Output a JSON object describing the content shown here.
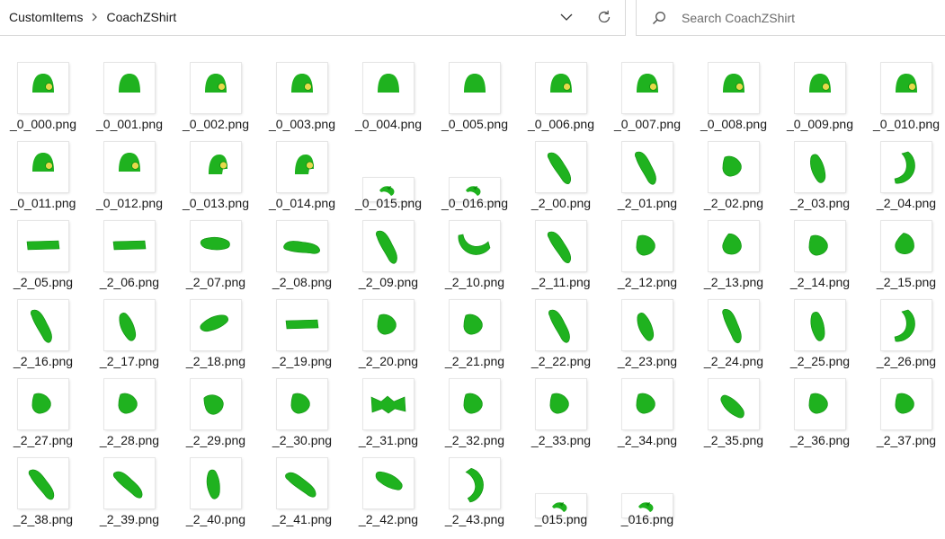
{
  "address": {
    "breadcrumbs": [
      "CustomItems",
      "CoachZShirt"
    ],
    "separator_icon": "chevron-right-icon",
    "dropdown_icon": "chevron-down-icon",
    "refresh_icon": "refresh-icon"
  },
  "search": {
    "placeholder": "Search CoachZShirt",
    "icon": "search-icon"
  },
  "colors": {
    "shape_green": "#1fb21f",
    "shape_green_dark": "#0d8f0d",
    "badge_yellow": "#e6d94a"
  },
  "files": [
    {
      "name": "_0_000.png",
      "kind": "hat-badge"
    },
    {
      "name": "_0_001.png",
      "kind": "hat"
    },
    {
      "name": "_0_002.png",
      "kind": "hat-badge"
    },
    {
      "name": "_0_003.png",
      "kind": "hat-badge"
    },
    {
      "name": "_0_004.png",
      "kind": "hat"
    },
    {
      "name": "_0_005.png",
      "kind": "hat"
    },
    {
      "name": "_0_006.png",
      "kind": "hat-badge"
    },
    {
      "name": "_0_007.png",
      "kind": "hat-badge"
    },
    {
      "name": "_0_008.png",
      "kind": "hat-badge"
    },
    {
      "name": "_0_009.png",
      "kind": "hat-badge"
    },
    {
      "name": "_0_010.png",
      "kind": "hat-badge"
    },
    {
      "name": "_0_011.png",
      "kind": "hat-badge"
    },
    {
      "name": "_0_012.png",
      "kind": "hat-badge"
    },
    {
      "name": "_0_013.png",
      "kind": "hat-half"
    },
    {
      "name": "_0_014.png",
      "kind": "hat-half"
    },
    {
      "name": "_0_015.png",
      "kind": "strip"
    },
    {
      "name": "_0_016.png",
      "kind": "strip"
    },
    {
      "name": "_2_00.png",
      "kind": "piece",
      "shape": 1,
      "rot": 30
    },
    {
      "name": "_2_01.png",
      "kind": "piece",
      "shape": 1,
      "rot": 35
    },
    {
      "name": "_2_02.png",
      "kind": "piece",
      "shape": 4,
      "rot": 0
    },
    {
      "name": "_2_03.png",
      "kind": "piece",
      "shape": 0,
      "rot": -55
    },
    {
      "name": "_2_04.png",
      "kind": "piece",
      "shape": 3,
      "rot": 0
    },
    {
      "name": "_2_05.png",
      "kind": "piece",
      "shape": 2,
      "rot": 0
    },
    {
      "name": "_2_06.png",
      "kind": "piece",
      "shape": 2,
      "rot": 0
    },
    {
      "name": "_2_07.png",
      "kind": "piece",
      "shape": 0,
      "rot": 55
    },
    {
      "name": "_2_08.png",
      "kind": "piece",
      "shape": 1,
      "rot": -20
    },
    {
      "name": "_2_09.png",
      "kind": "piece",
      "shape": 1,
      "rot": 35
    },
    {
      "name": "_2_10.png",
      "kind": "piece",
      "shape": 3,
      "rot": 90
    },
    {
      "name": "_2_11.png",
      "kind": "piece",
      "shape": 1,
      "rot": 30
    },
    {
      "name": "_2_12.png",
      "kind": "piece",
      "shape": 4,
      "rot": 0
    },
    {
      "name": "_2_13.png",
      "kind": "piece",
      "shape": 4,
      "rot": 20
    },
    {
      "name": "_2_14.png",
      "kind": "piece",
      "shape": 4,
      "rot": 0
    },
    {
      "name": "_2_15.png",
      "kind": "piece",
      "shape": 4,
      "rot": 30
    },
    {
      "name": "_2_16.png",
      "kind": "piece",
      "shape": 1,
      "rot": 35
    },
    {
      "name": "_2_17.png",
      "kind": "piece",
      "shape": 0,
      "rot": -60
    },
    {
      "name": "_2_18.png",
      "kind": "piece",
      "shape": 0,
      "rot": 30
    },
    {
      "name": "_2_19.png",
      "kind": "piece",
      "shape": 2,
      "rot": 0
    },
    {
      "name": "_2_20.png",
      "kind": "piece",
      "shape": 4,
      "rot": 0
    },
    {
      "name": "_2_21.png",
      "kind": "piece",
      "shape": 4,
      "rot": 0
    },
    {
      "name": "_2_22.png",
      "kind": "piece",
      "shape": 1,
      "rot": 35
    },
    {
      "name": "_2_23.png",
      "kind": "piece",
      "shape": 0,
      "rot": -60
    },
    {
      "name": "_2_24.png",
      "kind": "piece",
      "shape": 1,
      "rot": 40
    },
    {
      "name": "_2_25.png",
      "kind": "piece",
      "shape": 0,
      "rot": -50
    },
    {
      "name": "_2_26.png",
      "kind": "piece",
      "shape": 3,
      "rot": 0
    },
    {
      "name": "_2_27.png",
      "kind": "piece",
      "shape": 4,
      "rot": 0
    },
    {
      "name": "_2_28.png",
      "kind": "piece",
      "shape": 4,
      "rot": 0
    },
    {
      "name": "_2_29.png",
      "kind": "piece",
      "shape": 4,
      "rot": -20
    },
    {
      "name": "_2_30.png",
      "kind": "piece",
      "shape": 4,
      "rot": 0
    },
    {
      "name": "_2_31.png",
      "kind": "piece",
      "shape": 5,
      "rot": 0
    },
    {
      "name": "_2_32.png",
      "kind": "piece",
      "shape": 4,
      "rot": 0
    },
    {
      "name": "_2_33.png",
      "kind": "piece",
      "shape": 4,
      "rot": 0
    },
    {
      "name": "_2_34.png",
      "kind": "piece",
      "shape": 4,
      "rot": 0
    },
    {
      "name": "_2_35.png",
      "kind": "piece",
      "shape": 0,
      "rot": -85
    },
    {
      "name": "_2_36.png",
      "kind": "piece",
      "shape": 4,
      "rot": 0
    },
    {
      "name": "_2_37.png",
      "kind": "piece",
      "shape": 4,
      "rot": 0
    },
    {
      "name": "_2_38.png",
      "kind": "piece",
      "shape": 1,
      "rot": 25
    },
    {
      "name": "_2_39.png",
      "kind": "piece",
      "shape": 1,
      "rot": 15
    },
    {
      "name": "_2_40.png",
      "kind": "piece",
      "shape": 0,
      "rot": -45
    },
    {
      "name": "_2_41.png",
      "kind": "piece",
      "shape": 1,
      "rot": 10
    },
    {
      "name": "_2_42.png",
      "kind": "piece",
      "shape": 0,
      "rot": 80
    },
    {
      "name": "_2_43.png",
      "kind": "piece",
      "shape": 3,
      "rot": -20
    },
    {
      "name": "_015.png",
      "kind": "strip"
    },
    {
      "name": "_016.png",
      "kind": "strip"
    }
  ]
}
